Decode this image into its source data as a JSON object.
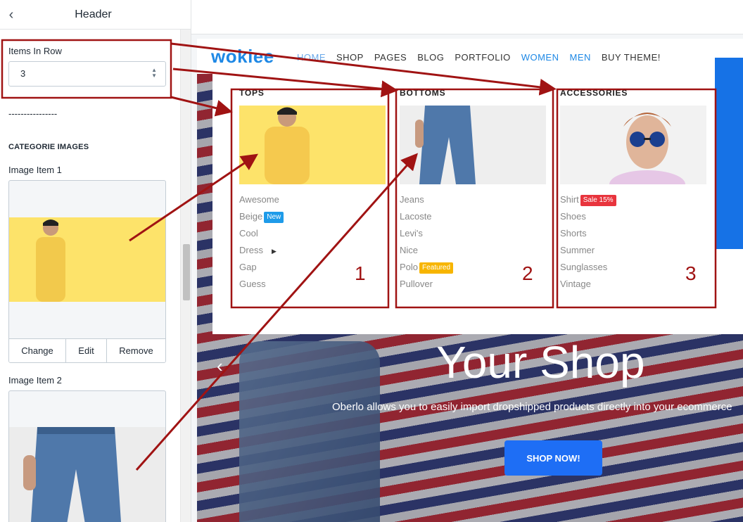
{
  "panel": {
    "back_icon": "chevron-left-icon",
    "title": "Header",
    "items_in_row_label": "Items In Row",
    "items_in_row_value": "3",
    "divider_text": "----------------",
    "category_images_heading": "CATEGORIE IMAGES",
    "image_items": [
      {
        "label": "Image Item 1",
        "actions": [
          "Change",
          "Edit",
          "Remove"
        ]
      },
      {
        "label": "Image Item 2"
      }
    ]
  },
  "site": {
    "logo": "wokiee",
    "nav": [
      "HOME",
      "SHOP",
      "PAGES",
      "BLOG",
      "PORTFOLIO",
      "WOMEN",
      "MEN",
      "BUY THEME!"
    ],
    "mega_menu": {
      "columns": [
        {
          "title": "TOPS",
          "number": "1",
          "links": [
            {
              "text": "Awesome"
            },
            {
              "text": "Beige",
              "badge": "New",
              "badge_color": "#1e9be9"
            },
            {
              "text": "Cool"
            },
            {
              "text": "Dress",
              "has_submenu": true
            },
            {
              "text": "Gap"
            },
            {
              "text": "Guess"
            }
          ]
        },
        {
          "title": "BOTTOMS",
          "number": "2",
          "links": [
            {
              "text": "Jeans"
            },
            {
              "text": "Lacoste"
            },
            {
              "text": "Levi's"
            },
            {
              "text": "Nice"
            },
            {
              "text": "Polo",
              "badge": "Featured",
              "badge_color": "#f7b500"
            },
            {
              "text": "Pullover"
            }
          ]
        },
        {
          "title": "ACCESSORIES",
          "number": "3",
          "links": [
            {
              "text": "Shirt",
              "badge": "Sale 15%",
              "badge_color": "#e8343d"
            },
            {
              "text": "Shoes"
            },
            {
              "text": "Shorts"
            },
            {
              "text": "Summer"
            },
            {
              "text": "Sunglasses"
            },
            {
              "text": "Vintage"
            }
          ]
        }
      ]
    },
    "hero": {
      "title": "Your Shop",
      "subtitle": "Oberlo allows you to easily import dropshipped products directly into your ecommerce",
      "button": "SHOP NOW!"
    }
  },
  "colors": {
    "accent_blue": "#1e88e5",
    "annotation_red": "#a01313",
    "button_blue": "#1e6ef5"
  }
}
